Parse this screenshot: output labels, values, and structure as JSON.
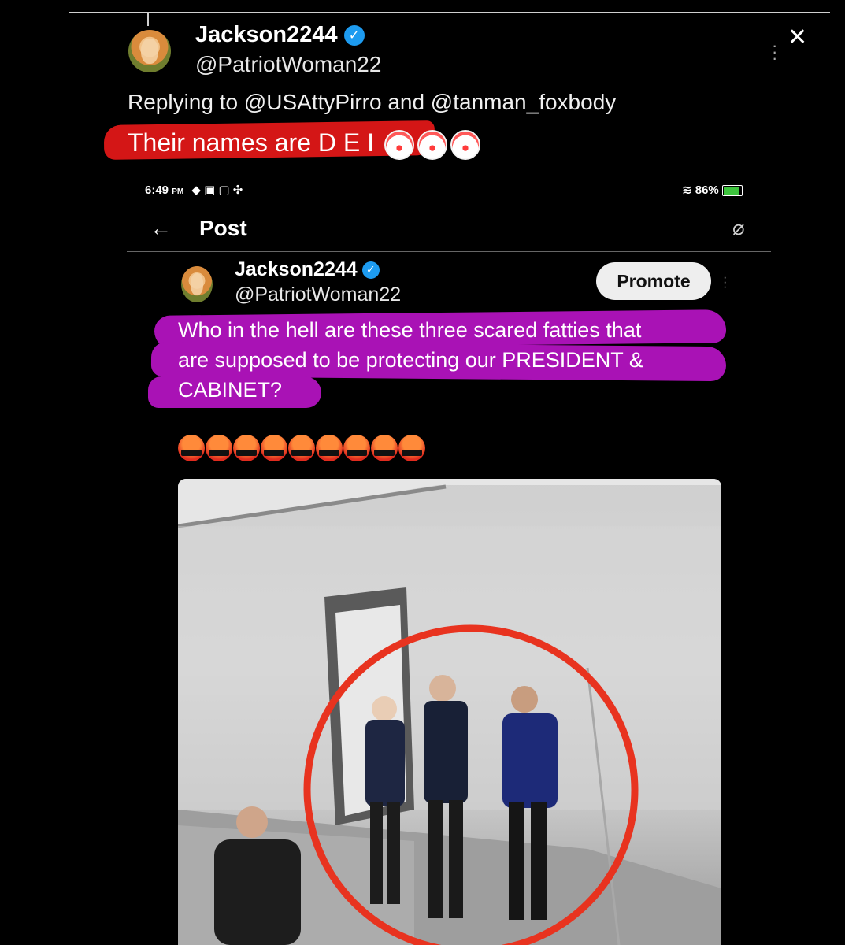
{
  "outer_tweet": {
    "display_name": "Jackson2244",
    "handle": "@PatriotWoman22",
    "replying_to": "Replying to @USAttyPirro and @tanman_foxbody",
    "text": "Their names are D E I",
    "emojis": [
      "clown-face",
      "clown-face",
      "clown-face"
    ]
  },
  "screenshot": {
    "status_bar": {
      "time": "6:49",
      "ampm": "PM",
      "battery": "86%"
    },
    "header": {
      "title": "Post"
    },
    "tweet": {
      "display_name": "Jackson2244",
      "handle": "@PatriotWoman22",
      "promote_label": "Promote",
      "text_line1": "Who in the hell are these three scared fatties that",
      "text_line2": "are supposed to be protecting our PRESIDENT &",
      "text_line3": "CABINET?",
      "emojis": [
        "face-with-symbols-on-mouth",
        "face-with-symbols-on-mouth",
        "face-with-symbols-on-mouth",
        "face-with-symbols-on-mouth",
        "face-with-symbols-on-mouth",
        "face-with-symbols-on-mouth",
        "face-with-symbols-on-mouth",
        "face-with-symbols-on-mouth",
        "face-with-symbols-on-mouth"
      ]
    }
  },
  "colors": {
    "background": "#000000",
    "red_highlight": "#d41616",
    "purple_highlight": "#a912b5",
    "verified": "#1d9bf0",
    "circle_annotation": "#e8331f"
  }
}
